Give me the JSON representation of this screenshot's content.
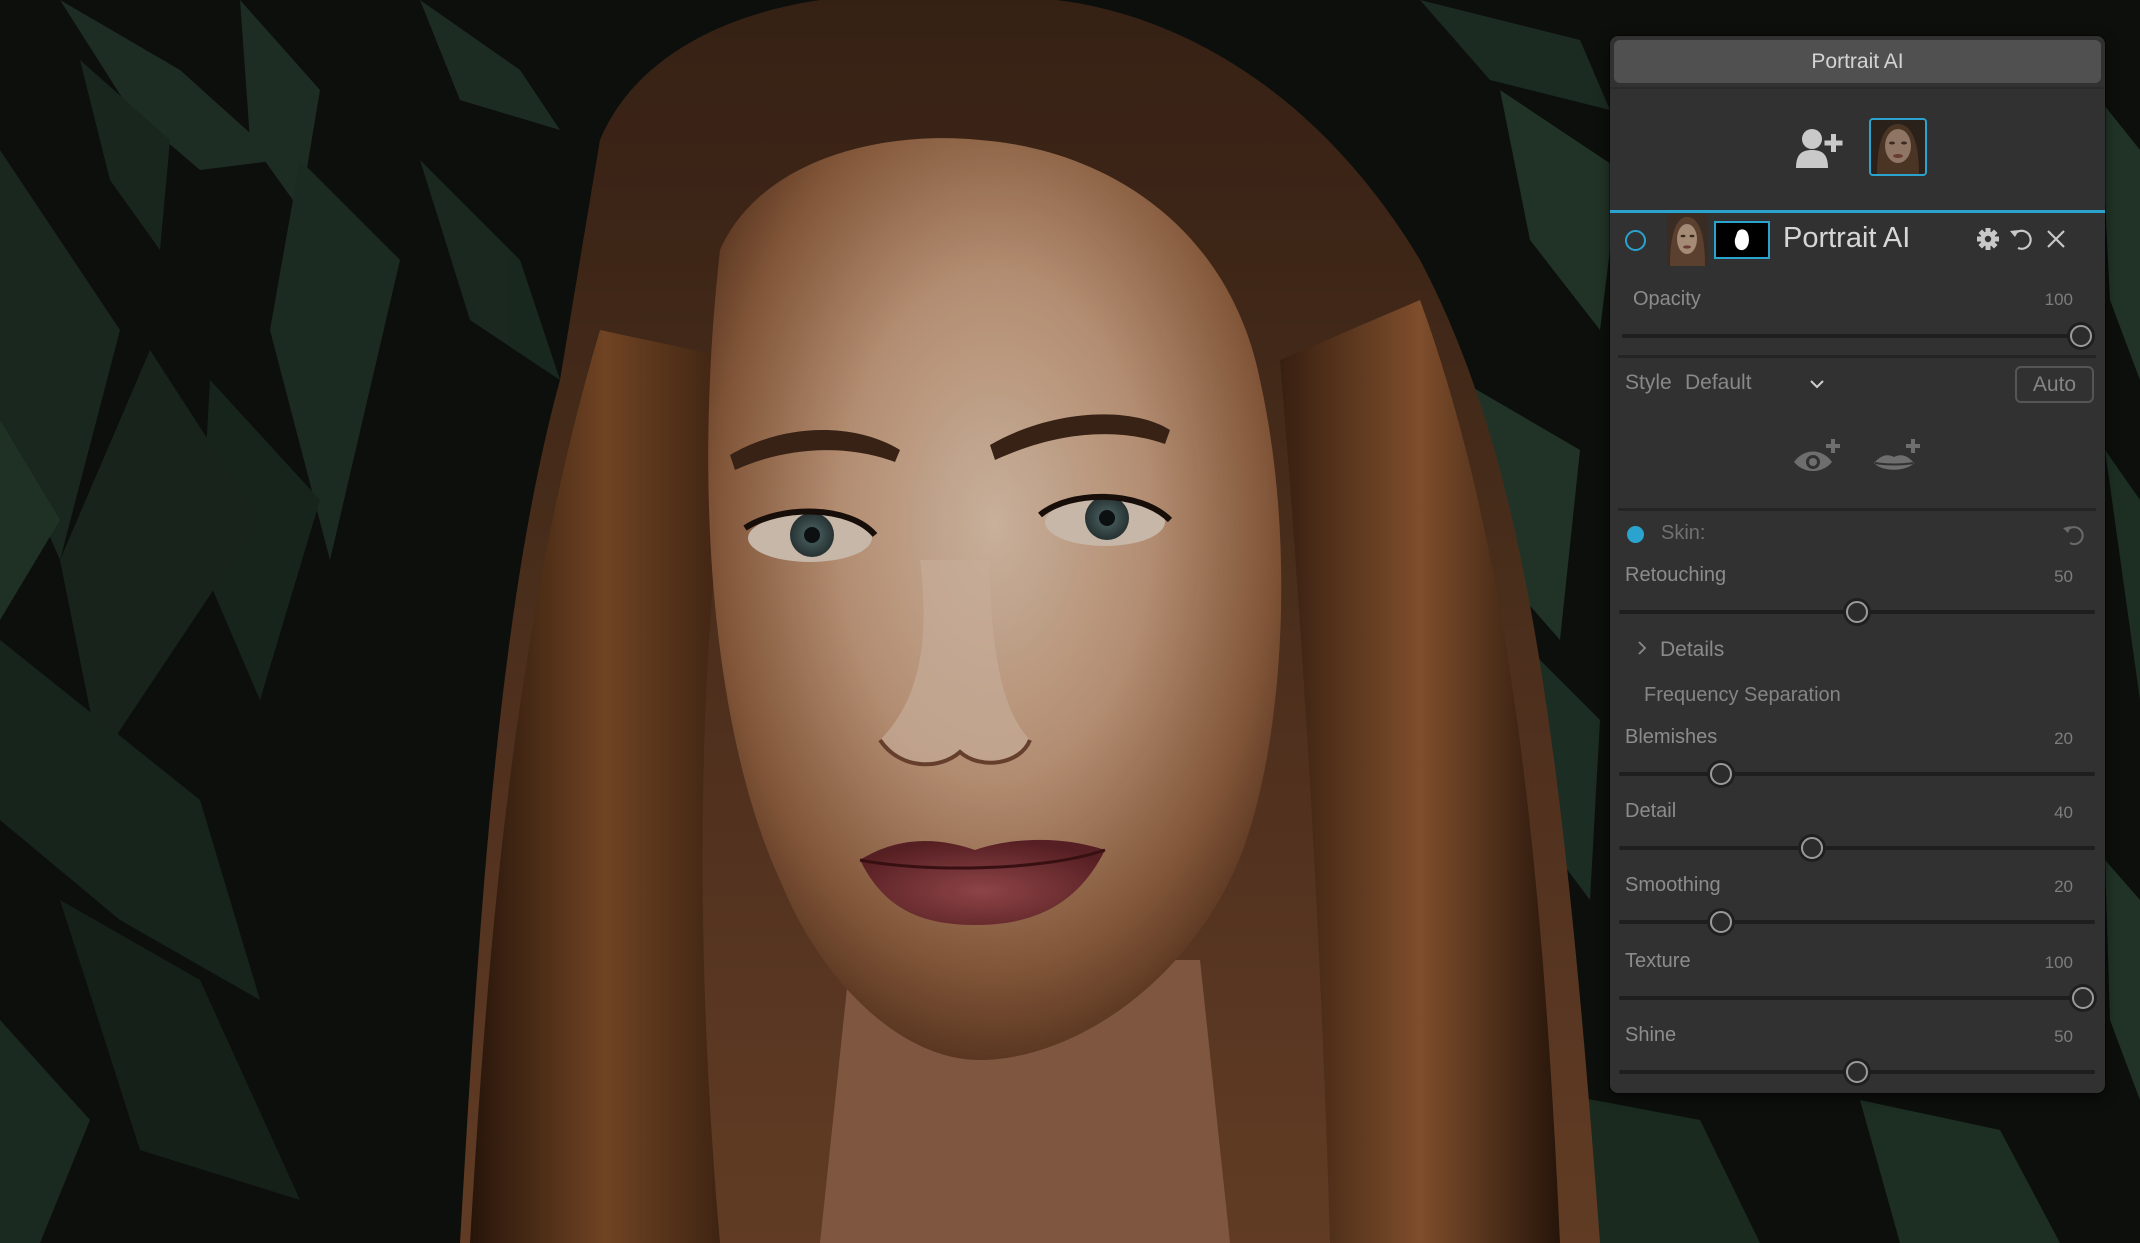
{
  "panel": {
    "title": "Portrait AI",
    "faces": {
      "add_face_icon": "person-plus-icon",
      "selected_face_thumbnail": "face-thumbnail"
    },
    "layer": {
      "name": "Portrait AI",
      "icons": {
        "settings": "gear-icon",
        "reset": "undo-icon",
        "remove": "close-icon"
      }
    },
    "opacity": {
      "label": "Opacity",
      "value": "100",
      "fraction": 1.0
    },
    "style": {
      "label": "Style",
      "selected": "Default",
      "auto_button": "Auto"
    },
    "feature_buttons": [
      {
        "name": "add-eye",
        "icon": "eye-plus-icon"
      },
      {
        "name": "add-lips",
        "icon": "lips-plus-icon"
      }
    ],
    "skin": {
      "label": "Skin:",
      "enabled": true,
      "retouching": {
        "label": "Retouching",
        "value": "50",
        "fraction": 0.5
      },
      "details": {
        "label": "Details",
        "expanded": false
      },
      "frequency_separation": "Frequency Separation",
      "sliders": [
        {
          "label": "Blemishes",
          "value": "20",
          "fraction": 0.2
        },
        {
          "label": "Detail",
          "value": "40",
          "fraction": 0.4
        },
        {
          "label": "Smoothing",
          "value": "20",
          "fraction": 0.2
        },
        {
          "label": "Texture",
          "value": "100",
          "fraction": 1.0
        },
        {
          "label": "Shine",
          "value": "50",
          "fraction": 0.5
        }
      ]
    }
  },
  "colors": {
    "accent": "#2aa4cf",
    "panel_bg": "#313131",
    "title_button_bg": "#505050"
  }
}
